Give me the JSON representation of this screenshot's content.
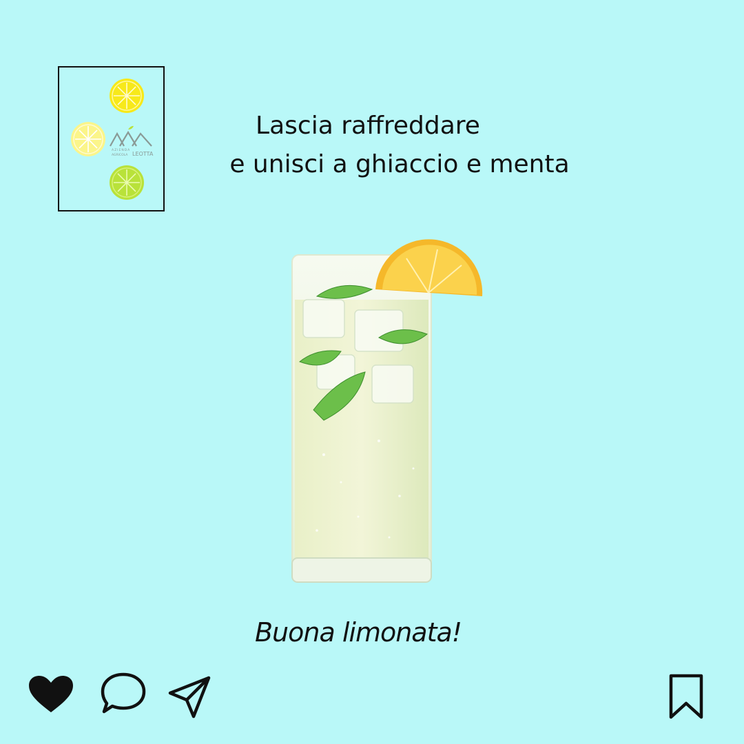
{
  "logo": {
    "name": "AZIENDA AGRICOLA LEOTTA",
    "line1": "AZIENDA",
    "line2": "AGRICOLA",
    "brand": "LEOTTA"
  },
  "headline": {
    "line1": "Lascia raffreddare",
    "line2": "e unisci a ghiaccio e menta"
  },
  "image": {
    "subject": "glass of lemonade with ice, mint leaves and lemon slice"
  },
  "tagline": "Buona limonata!",
  "actions": {
    "like": "heart-icon",
    "comment": "comment-icon",
    "share": "send-icon",
    "save": "bookmark-icon"
  },
  "colors": {
    "background": "#b9f8f8",
    "lemon_yellow": "#f7e91a",
    "lemon_pale": "#fbf58a",
    "lime_green": "#b9e23a",
    "logo_grey": "#8a9a96",
    "icons": "#111111"
  }
}
